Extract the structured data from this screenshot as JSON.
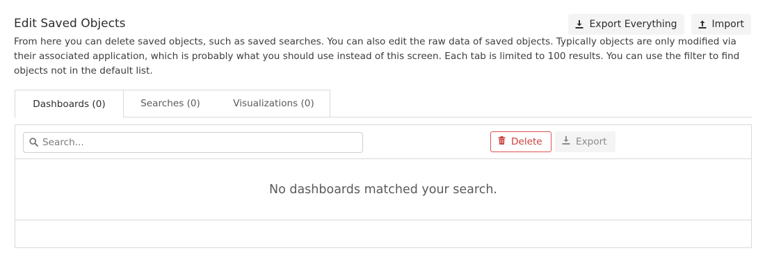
{
  "header": {
    "title": "Edit Saved Objects",
    "export_everything_label": "Export Everything",
    "import_label": "Import"
  },
  "description": "From here you can delete saved objects, such as saved searches. You can also edit the raw data of saved objects. Typically objects are only modified via their associated application, which is probably what you should use instead of this screen. Each tab is limited to 100 results. You can use the filter to find objects not in the default list.",
  "tabs": [
    {
      "label": "Dashboards (0)",
      "active": true
    },
    {
      "label": "Searches (0)",
      "active": false
    },
    {
      "label": "Visualizations (0)",
      "active": false
    }
  ],
  "toolbar": {
    "search_placeholder": "Search...",
    "search_value": "",
    "delete_label": "Delete",
    "export_label": "Export"
  },
  "results": {
    "empty_message": "No dashboards matched your search."
  },
  "icons": {
    "export_everything": "download-icon",
    "import": "upload-icon",
    "search": "search-icon",
    "delete": "trash-icon",
    "export": "download-icon"
  },
  "colors": {
    "danger": "#d9534f",
    "button_bg": "#f4f4f4",
    "border": "#d9d9d9"
  }
}
